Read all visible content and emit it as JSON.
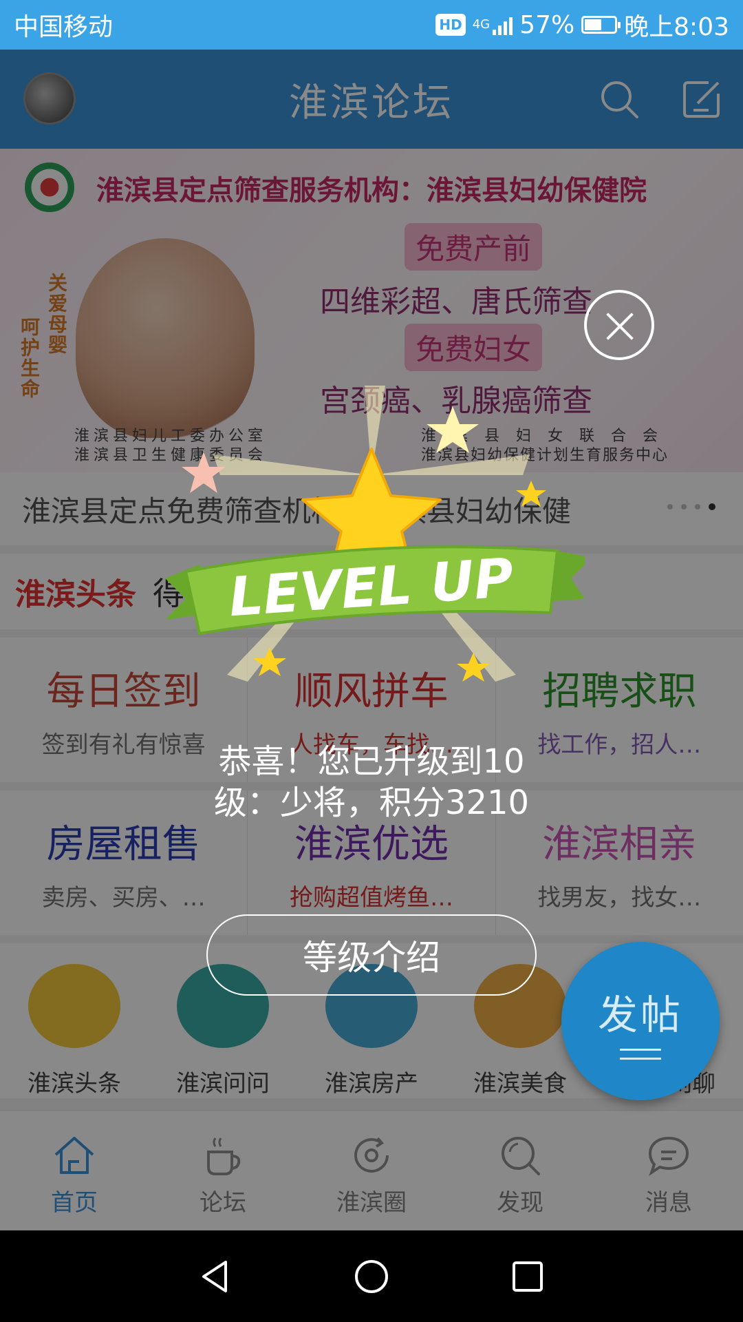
{
  "status_bar": {
    "carrier": "中国移动",
    "hd_badge": "HD",
    "network": "4G",
    "battery_percent": "57%",
    "battery_level": 0.57,
    "time": "晚上8:03"
  },
  "header": {
    "title": "淮滨论坛",
    "avatar_icon": "user-avatar",
    "search_icon": "search-icon",
    "compose_icon": "edit-icon"
  },
  "banner": {
    "headline": "淮滨县定点筛查服务机构：淮滨县妇幼保健院",
    "tag1": "免费产前",
    "line1": "四维彩超、唐氏筛查",
    "tag2": "免费妇女",
    "line2": "宫颈癌、乳腺癌筛查",
    "vertical_left": "呵护生命",
    "vertical_right": "关爱母婴",
    "org_left_1": "淮滨县妇儿工委办公室",
    "org_left_2": "淮滨县卫生健康委员会",
    "org_right_1": "淮滨县妇女联合会",
    "org_right_2": "淮滨县妇幼保健计划生育服务中心"
  },
  "ticker": {
    "text": "淮滨县定点免费筛查机构：淮滨县妇幼保健",
    "page_count": 4,
    "active_page": 4
  },
  "headline_row": {
    "label": "淮滨头条",
    "text": "得… 店转让…"
  },
  "grid_row1": [
    {
      "title": "每日签到",
      "subtitle": "签到有礼有惊喜",
      "title_color": "#c0392b",
      "subtitle_color": "#666666"
    },
    {
      "title": "顺风拼车",
      "subtitle": "人找车，车找…",
      "title_color": "#d62020",
      "subtitle_color": "#d62020"
    },
    {
      "title": "招聘求职",
      "subtitle": "找工作，招人…",
      "title_color": "#1b8a1b",
      "subtitle_color": "#7b4fb0"
    }
  ],
  "grid_row2": [
    {
      "title": "房屋租售",
      "subtitle": "卖房、买房、…",
      "title_color": "#1a2fb0",
      "subtitle_color": "#666666"
    },
    {
      "title": "淮滨优选",
      "subtitle": "抢购超值烤鱼…",
      "title_color": "#6a1fa8",
      "subtitle_color": "#d62020"
    },
    {
      "title": "淮滨相亲",
      "subtitle": "找男友，找女…",
      "title_color": "#c64bb0",
      "subtitle_color": "#666666"
    }
  ],
  "icon_row": [
    {
      "label": "淮滨头条",
      "icon": "reading-person-icon",
      "color": "#f2c42c"
    },
    {
      "label": "淮滨问问",
      "icon": "number-blocks-icon",
      "color": "#29a6a0"
    },
    {
      "label": "淮滨房产",
      "icon": "house-icon",
      "color": "#3aa5d6"
    },
    {
      "label": "淮滨美食",
      "icon": "chef-icon",
      "color": "#f0a93a"
    },
    {
      "label": "淮滨闲聊",
      "icon": "chat-icon",
      "color": "#e86b6b"
    }
  ],
  "tabbar": [
    {
      "label": "首页",
      "icon": "home-icon",
      "active": true
    },
    {
      "label": "论坛",
      "icon": "coffee-icon",
      "active": false
    },
    {
      "label": "淮滨圈",
      "icon": "refresh-circle-icon",
      "active": false
    },
    {
      "label": "发现",
      "icon": "discover-search-icon",
      "active": false
    },
    {
      "label": "消息",
      "icon": "message-icon",
      "active": false
    }
  ],
  "fab": {
    "label": "发帖"
  },
  "popup": {
    "badge_text": "LEVEL UP",
    "message": "恭喜！您已升级到10级：少将，积分3210",
    "button": "等级介绍",
    "close_icon": "close-icon"
  },
  "colors": {
    "status_bar": "#3ba4e6",
    "app_bar": "#2a8ad4",
    "ribbon": "#8cc63f",
    "star": "#ffd21f",
    "active_tab": "#2a8ad4"
  }
}
